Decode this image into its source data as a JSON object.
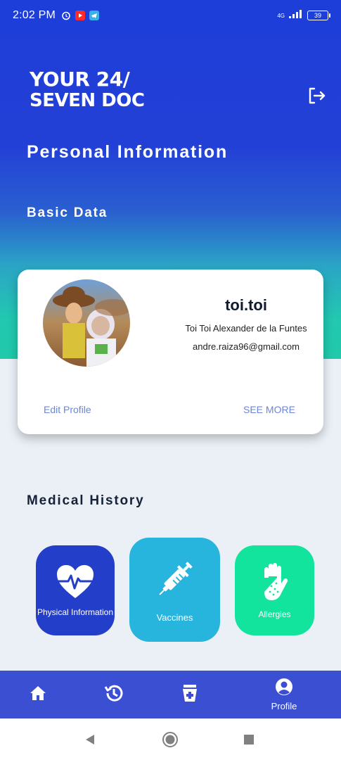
{
  "status_bar": {
    "time": "2:02 PM",
    "network": "4G",
    "battery": "39"
  },
  "header": {
    "logo_line1": "YOUR 24/",
    "logo_line2": "SEVEN DOC",
    "title": "Personal Information",
    "subtitle": "Basic Data"
  },
  "profile": {
    "username": "toi.toi",
    "full_name": "Toi Toi Alexander de la Funtes",
    "email": "andre.raiza96@gmail.com",
    "edit_label": "Edit Profile",
    "see_more_label": "SEE MORE"
  },
  "medical": {
    "title": "Medical History",
    "tiles": [
      {
        "label": "Physical Information",
        "icon": "heart-pulse-icon",
        "color": "#233ec9"
      },
      {
        "label": "Vaccines",
        "icon": "syringe-icon",
        "color": "#27b5dd"
      },
      {
        "label": "Allergies",
        "icon": "allergy-hand-icon",
        "color": "#13e49d"
      }
    ]
  },
  "bottom_nav": {
    "items": [
      {
        "icon": "home-icon",
        "label": ""
      },
      {
        "icon": "history-icon",
        "label": ""
      },
      {
        "icon": "medical-kit-icon",
        "label": ""
      },
      {
        "icon": "profile-icon",
        "label": "Profile"
      }
    ]
  },
  "colors": {
    "primary": "#1f3ed8",
    "teal": "#20c9a9",
    "link": "#6b86d8",
    "nav": "#3a4fd2"
  }
}
